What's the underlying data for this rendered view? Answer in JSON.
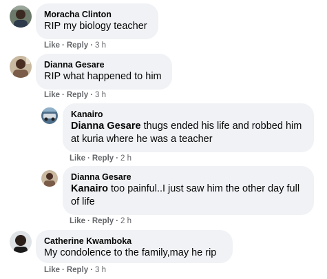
{
  "comments": [
    {
      "author": "Moracha Clinton",
      "text": "RIP my biology teacher",
      "like": "Like",
      "reply": "Reply",
      "time": "3 h"
    },
    {
      "author": "Dianna Gesare",
      "text": "RIP what happened to him",
      "like": "Like",
      "reply": "Reply",
      "time": "3 h"
    },
    {
      "author": "Kanairo",
      "mention": "Dianna Gesare",
      "text": " thugs ended his life and robbed him at kuria where he was a teacher",
      "like": "Like",
      "reply": "Reply",
      "time": "2 h"
    },
    {
      "author": "Dianna Gesare",
      "mention": "Kanairo",
      "text": " too painful..I just saw him the other day full of life",
      "like": "Like",
      "reply": "Reply",
      "time": "2 h"
    },
    {
      "author": "Catherine Kwamboka",
      "text": "My condolence to the family,may he rip",
      "like": "Like",
      "reply": "Reply",
      "time": "3 h"
    }
  ],
  "separator": "·"
}
